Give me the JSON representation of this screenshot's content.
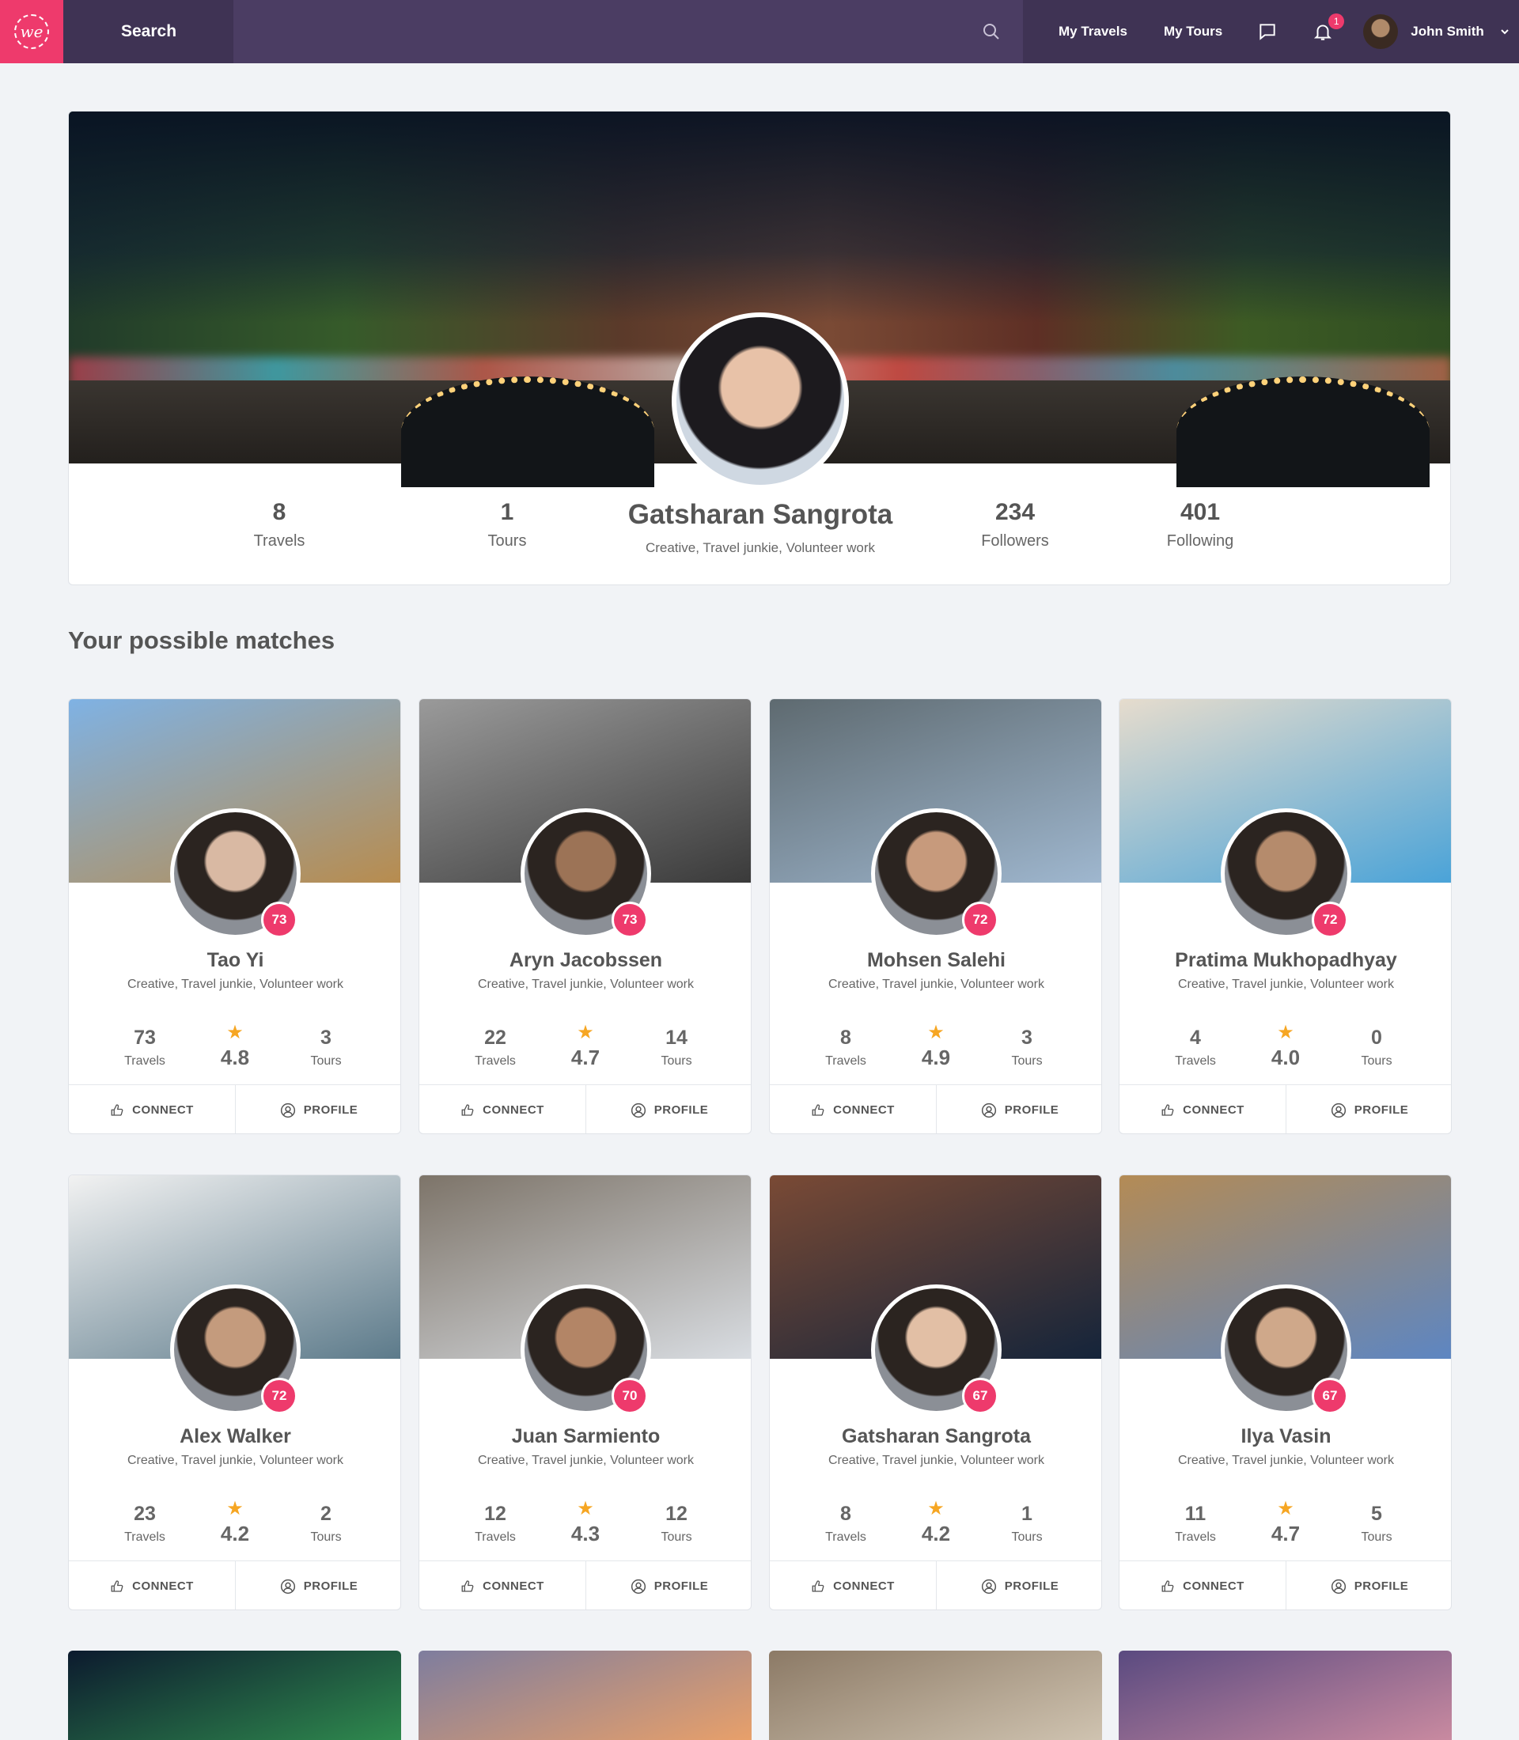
{
  "header": {
    "logo_text": "we",
    "search_label": "Search",
    "nav": [
      "My Travels",
      "My Tours"
    ],
    "notification_count": "1",
    "user_name": "John Smith"
  },
  "profile": {
    "name": "Gatsharan Sangrota",
    "tags": "Creative, Travel junkie, Volunteer work",
    "stats": {
      "travels": {
        "value": "8",
        "label": "Travels"
      },
      "tours": {
        "value": "1",
        "label": "Tours"
      },
      "followers": {
        "value": "234",
        "label": "Followers"
      },
      "following": {
        "value": "401",
        "label": "Following"
      }
    }
  },
  "matches": {
    "title": "Your possible matches",
    "labels": {
      "travels": "Travels",
      "tours": "Tours",
      "connect": "CONNECT",
      "profile": "PROFILE"
    },
    "cards": [
      {
        "name": "Tao Yi",
        "score": "73",
        "tags": "Creative, Travel junkie, Volunteer work",
        "travels": "73",
        "rating": "4.8",
        "tours": "3",
        "cover": "#b88c4e",
        "cover2": "#7fb2e4",
        "face": "#d9b9a3"
      },
      {
        "name": "Aryn Jacobssen",
        "score": "73",
        "tags": "Creative, Travel junkie, Volunteer work",
        "travels": "22",
        "rating": "4.7",
        "tours": "14",
        "cover": "#3a3a3a",
        "cover2": "#9a9a9a",
        "face": "#9c7356"
      },
      {
        "name": "Mohsen Salehi",
        "score": "72",
        "tags": "Creative, Travel junkie, Volunteer work",
        "travels": "8",
        "rating": "4.9",
        "tours": "3",
        "cover": "#9fb7cf",
        "cover2": "#5e6a70",
        "face": "#c79a7c"
      },
      {
        "name": "Pratima Mukhopadhyay",
        "score": "72",
        "tags": "Creative, Travel junkie, Volunteer work",
        "travels": "4",
        "rating": "4.0",
        "tours": "0",
        "cover": "#4aa3d8",
        "cover2": "#e6dccd",
        "face": "#b58b6c"
      },
      {
        "name": "Alex Walker",
        "score": "72",
        "tags": "Creative, Travel junkie, Volunteer work",
        "travels": "23",
        "rating": "4.2",
        "tours": "2",
        "cover": "#5c7a8a",
        "cover2": "#f2f2f2",
        "face": "#c49b7d"
      },
      {
        "name": "Juan Sarmiento",
        "score": "70",
        "tags": "Creative, Travel junkie, Volunteer work",
        "travels": "12",
        "rating": "4.3",
        "tours": "12",
        "cover": "#d9dde2",
        "cover2": "#7d7469",
        "face": "#b38566"
      },
      {
        "name": "Gatsharan Sangrota",
        "score": "67",
        "tags": "Creative, Travel junkie, Volunteer work",
        "travels": "8",
        "rating": "4.2",
        "tours": "1",
        "cover": "#14243a",
        "cover2": "#7a4a35",
        "face": "#e2bfa5"
      },
      {
        "name": "Ilya Vasin",
        "score": "67",
        "tags": "Creative, Travel junkie, Volunteer work",
        "travels": "11",
        "rating": "4.7",
        "tours": "5",
        "cover": "#5d86c2",
        "cover2": "#b48b55",
        "face": "#cfa88a"
      }
    ],
    "peek_covers": [
      {
        "c1": "#0c1a2e",
        "c2": "#2f8a4e"
      },
      {
        "c1": "#7e7d9e",
        "c2": "#e8a06a"
      },
      {
        "c1": "#8c7a66",
        "c2": "#cfc3b0"
      },
      {
        "c1": "#5a4a80",
        "c2": "#c98aa0"
      }
    ]
  }
}
